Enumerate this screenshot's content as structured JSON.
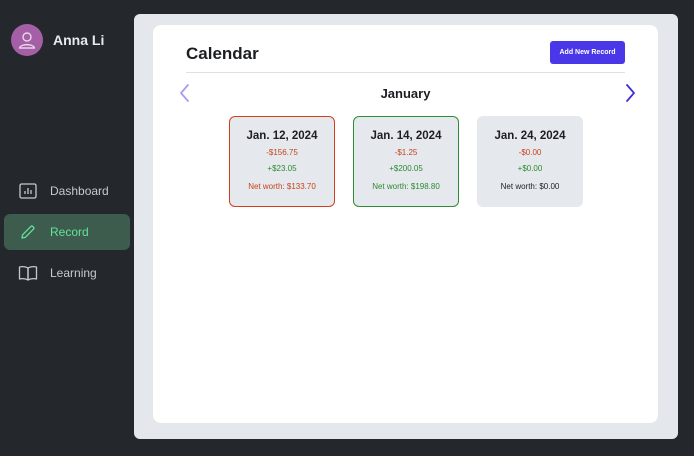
{
  "user": {
    "name": "Anna Li"
  },
  "nav": {
    "items": [
      {
        "label": "Dashboard",
        "icon": "chart-icon",
        "active": false
      },
      {
        "label": "Record",
        "icon": "pencil-icon",
        "active": true
      },
      {
        "label": "Learning",
        "icon": "book-icon",
        "active": false
      }
    ]
  },
  "calendar": {
    "title": "Calendar",
    "add_button_label": "Add New Record",
    "month": "January",
    "records": [
      {
        "date": "Jan. 12, 2024",
        "expense": "-$156.75",
        "income": "+$23.05",
        "net_worth": "Net worth: $133.70",
        "status": "loss"
      },
      {
        "date": "Jan. 14, 2024",
        "expense": "-$1.25",
        "income": "+$200.05",
        "net_worth": "Net worth: $198.80",
        "status": "gain"
      },
      {
        "date": "Jan. 24, 2024",
        "expense": "-$0.00",
        "income": "+$0.00",
        "net_worth": "Net worth: $0.00",
        "status": "neutral"
      }
    ]
  },
  "colors": {
    "sidebar_bg": "#24272b",
    "active_nav_bg": "#3d5c4e",
    "active_nav_text": "#63e29a",
    "accent_button": "#4a38e8",
    "loss": "#d23f1f",
    "gain": "#2f8e33"
  }
}
